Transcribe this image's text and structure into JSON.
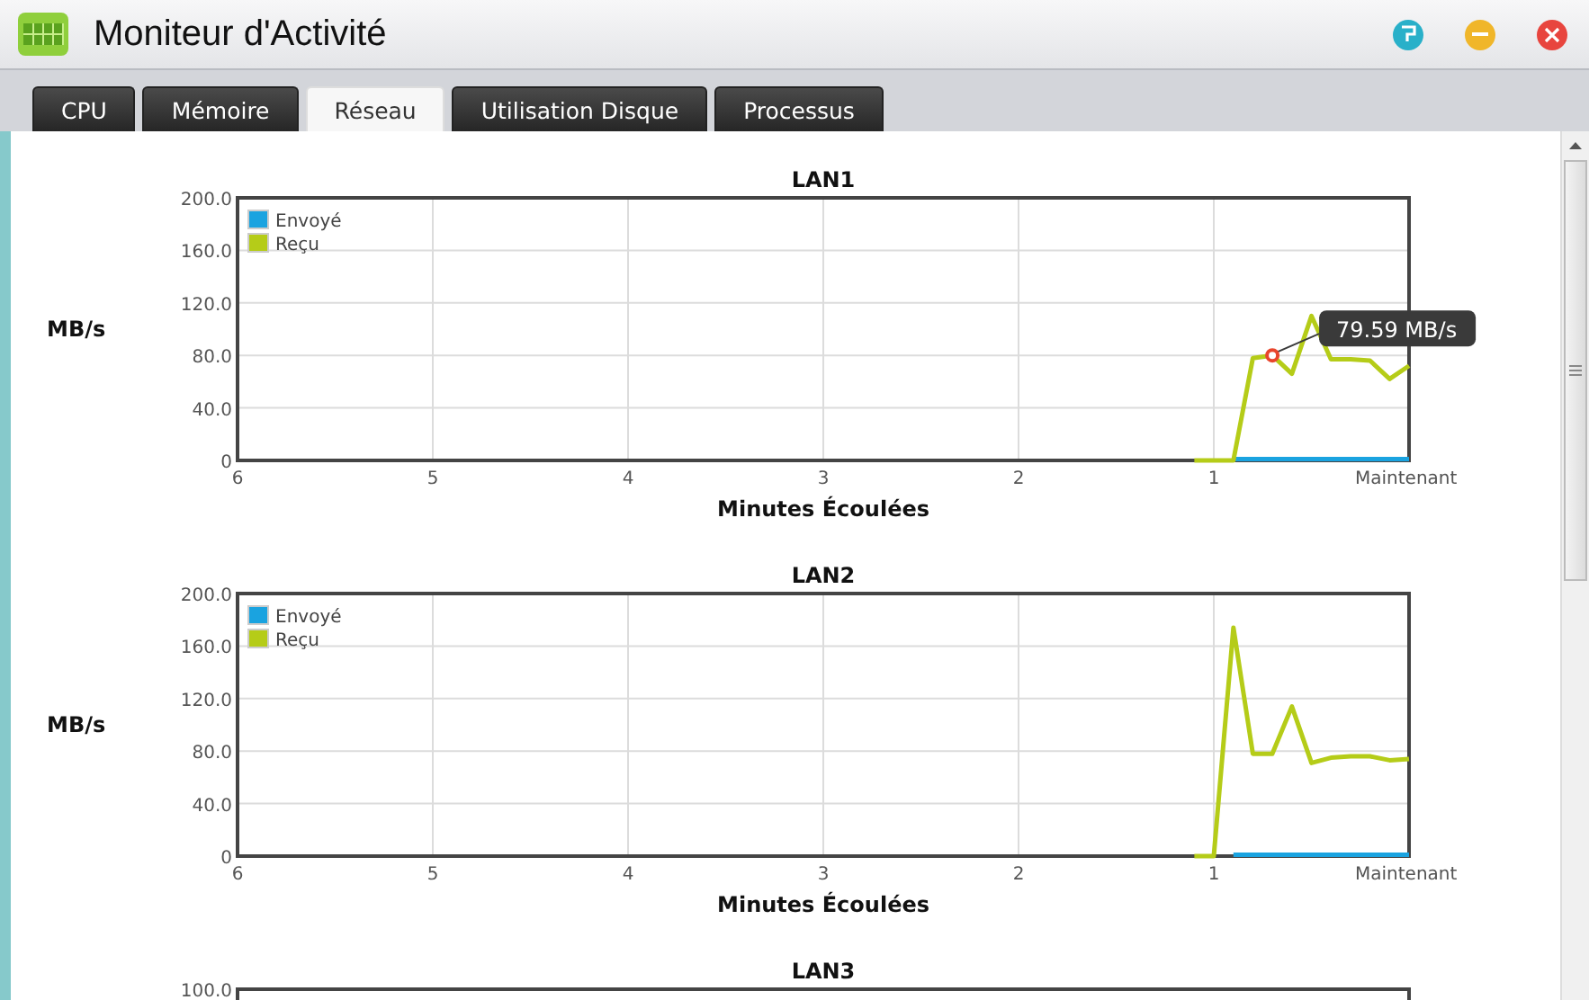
{
  "window": {
    "title": "Moniteur d'Activité"
  },
  "tabs": [
    {
      "label": "CPU",
      "selected": false
    },
    {
      "label": "Mémoire",
      "selected": false
    },
    {
      "label": "Réseau",
      "selected": true
    },
    {
      "label": "Utilisation Disque",
      "selected": false
    },
    {
      "label": "Processus",
      "selected": false
    }
  ],
  "charts": [
    {
      "chart_data": {
        "type": "line",
        "title": "LAN1",
        "xlabel": "Minutes Écoulées",
        "ylabel": "MB/s",
        "x": [
          1.1,
          1.0,
          0.9,
          0.8,
          0.7,
          0.6,
          0.5,
          0.4,
          0.3,
          0.2,
          0.1,
          0
        ],
        "series": [
          {
            "name": "Envoyé",
            "color": "#1aa3e0",
            "values": [
              null,
              null,
              1,
              1,
              1,
              1,
              1,
              1,
              1,
              1,
              1,
              1
            ]
          },
          {
            "name": "Reçu",
            "color": "#b5cc18",
            "values": [
              0,
              0,
              0,
              78,
              80,
              66,
              110,
              77,
              77,
              76,
              62,
              72
            ]
          }
        ],
        "grid": true,
        "legend": true,
        "xlim": [
          6,
          0
        ],
        "ylim": [
          0,
          200
        ],
        "xticks": [
          6,
          5,
          4,
          3,
          2,
          1,
          {
            "value": 0,
            "label": "Maintenant"
          }
        ],
        "yticks": [
          {
            "value": 0,
            "label": "0"
          },
          {
            "value": 40,
            "label": "40.0"
          },
          {
            "value": 80,
            "label": "80.0"
          },
          {
            "value": 120,
            "label": "120.0"
          },
          {
            "value": 160,
            "label": "160.0"
          },
          {
            "value": 200,
            "label": "200.0"
          }
        ],
        "annotations": [
          {
            "x": 0.7,
            "y": 80,
            "text": "79.59 MB/s"
          }
        ]
      }
    },
    {
      "chart_data": {
        "type": "line",
        "title": "LAN2",
        "xlabel": "Minutes Écoulées",
        "ylabel": "MB/s",
        "x": [
          1.1,
          1.0,
          0.9,
          0.8,
          0.7,
          0.6,
          0.5,
          0.4,
          0.3,
          0.2,
          0.1,
          0
        ],
        "series": [
          {
            "name": "Envoyé",
            "color": "#1aa3e0",
            "values": [
              null,
              null,
              1,
              1,
              1,
              1,
              1,
              1,
              1,
              1,
              1,
              1
            ]
          },
          {
            "name": "Reçu",
            "color": "#b5cc18",
            "values": [
              0,
              0,
              174,
              78,
              78,
              114,
              71,
              75,
              76,
              76,
              73,
              74
            ]
          }
        ],
        "grid": true,
        "legend": true,
        "xlim": [
          6,
          0
        ],
        "ylim": [
          0,
          200
        ],
        "xticks": [
          6,
          5,
          4,
          3,
          2,
          1,
          {
            "value": 0,
            "label": "Maintenant"
          }
        ],
        "yticks": [
          {
            "value": 0,
            "label": "0"
          },
          {
            "value": 40,
            "label": "40.0"
          },
          {
            "value": 80,
            "label": "80.0"
          },
          {
            "value": 120,
            "label": "120.0"
          },
          {
            "value": 160,
            "label": "160.0"
          },
          {
            "value": 200,
            "label": "200.0"
          }
        ]
      }
    },
    {
      "title": "LAN3",
      "top_label": "100.0"
    }
  ]
}
